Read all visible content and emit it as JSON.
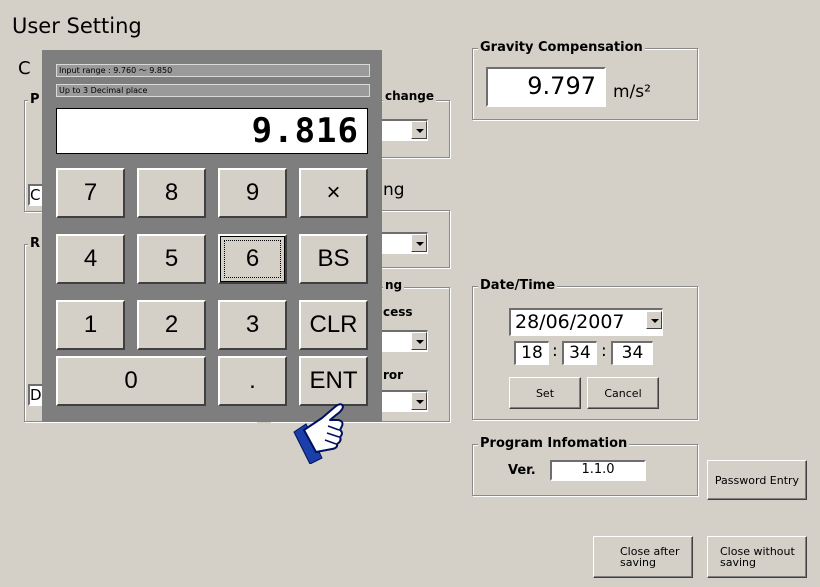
{
  "window": {
    "title": "User Setting"
  },
  "background": {
    "frag_c": "C",
    "frag_p": "P",
    "frag_change": "change",
    "frag_ng1": "ng",
    "frag_r": "R",
    "frag_ng2": "ng",
    "frag_cess": "cess",
    "frag_ror": "ror",
    "frag_c_field": "C",
    "frag_d_field": "D"
  },
  "gravity": {
    "label": "Gravity Compensation",
    "value": "9.797",
    "unit": "m/s²"
  },
  "keypad": {
    "info_range": "Input range : 9.760 ～ 9.850",
    "info_decimal": "Up to 3 Decimal place",
    "display": "9.816",
    "keys": {
      "k7": "7",
      "k8": "8",
      "k9": "9",
      "kmul": "×",
      "k4": "4",
      "k5": "5",
      "k6": "6",
      "kbs": "BS",
      "k1": "1",
      "k2": "2",
      "k3": "3",
      "kclr": "CLR",
      "k0": "0",
      "kdot": ".",
      "kent": "ENT"
    }
  },
  "datetime": {
    "label": "Date/Time",
    "date": "28/06/2007",
    "hour": "18",
    "minute": "34",
    "second": "34",
    "sep1": ":",
    "sep2": ":",
    "set_label": "Set",
    "cancel_label": "Cancel"
  },
  "program": {
    "label": "Program Infomation",
    "ver_label": "Ver.",
    "version": "1.1.0"
  },
  "buttons": {
    "password_entry": "Password Entry",
    "close_after_saving": "Close after saving",
    "close_without_saving": "Close without saving"
  },
  "icons": {
    "pointer": "pointing-hand-icon"
  }
}
